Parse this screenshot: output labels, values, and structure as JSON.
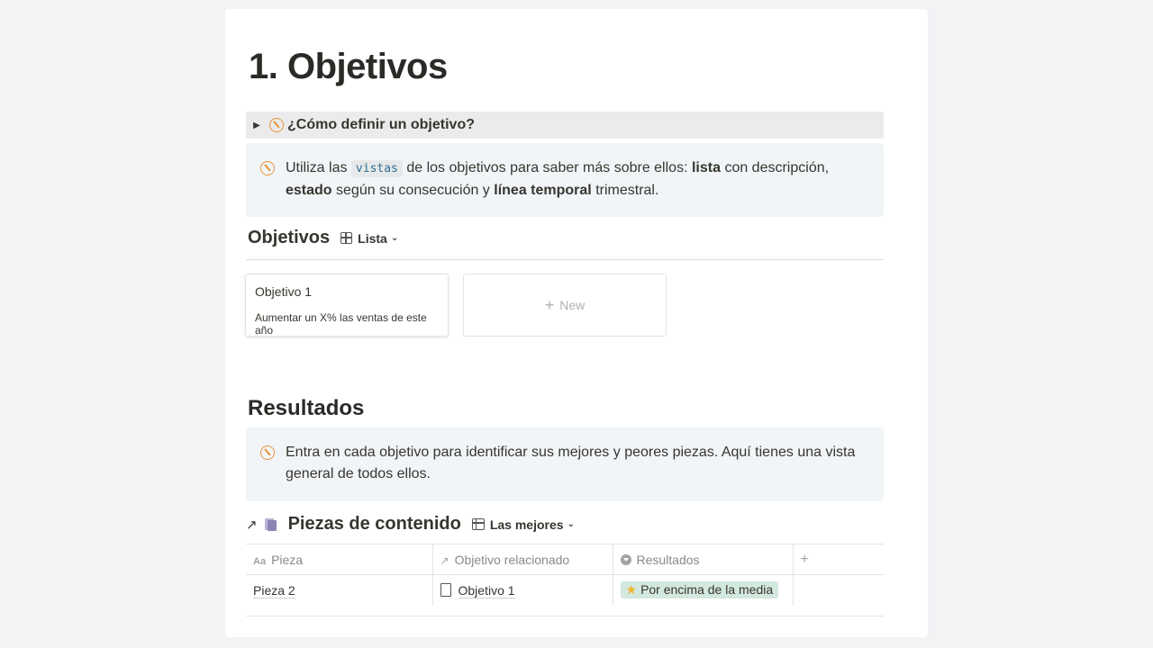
{
  "page": {
    "title": "1. Objetivos"
  },
  "toggle": {
    "label": "¿Cómo definir un objetivo?"
  },
  "callout1": {
    "part1": "Utiliza las",
    "code": "vistas",
    "part2": "de los objetivos para saber más sobre ellos:",
    "bold1": "lista",
    "part3": "con descripción,",
    "bold2": "estado",
    "part4": "según su consecución y",
    "bold3": "línea temporal",
    "part5": "trimestral."
  },
  "objetivos_db": {
    "title": "Objetivos",
    "view": "Lista",
    "cards": [
      {
        "name": "Objetivo 1",
        "description": "Aumentar un X% las ventas de este año"
      }
    ],
    "new_label": "New"
  },
  "resultados": {
    "heading": "Resultados",
    "callout": "Entra en cada objetivo para identificar sus mejores y peores piezas. Aquí tienes una vista general de todos ellos."
  },
  "piezas_db": {
    "title": "Piezas de contenido",
    "view": "Las mejores",
    "columns": {
      "pieza": "Pieza",
      "objetivo": "Objetivo relacionado",
      "resultados": "Resultados"
    },
    "rows": [
      {
        "pieza": "Pieza 2",
        "objetivo": "Objetivo 1",
        "resultado": "Por encima de la media"
      }
    ]
  },
  "colors": {
    "accent_orange": "#e8953b",
    "callout_bg": "#f1f5f8",
    "tag_green": "#d3e8df"
  },
  "icons": {
    "toggle": "triangle-right-icon",
    "callout": "compass-icon",
    "view": "grid-icon",
    "relation": "arrow-up-right-icon",
    "file": "file-icon"
  }
}
